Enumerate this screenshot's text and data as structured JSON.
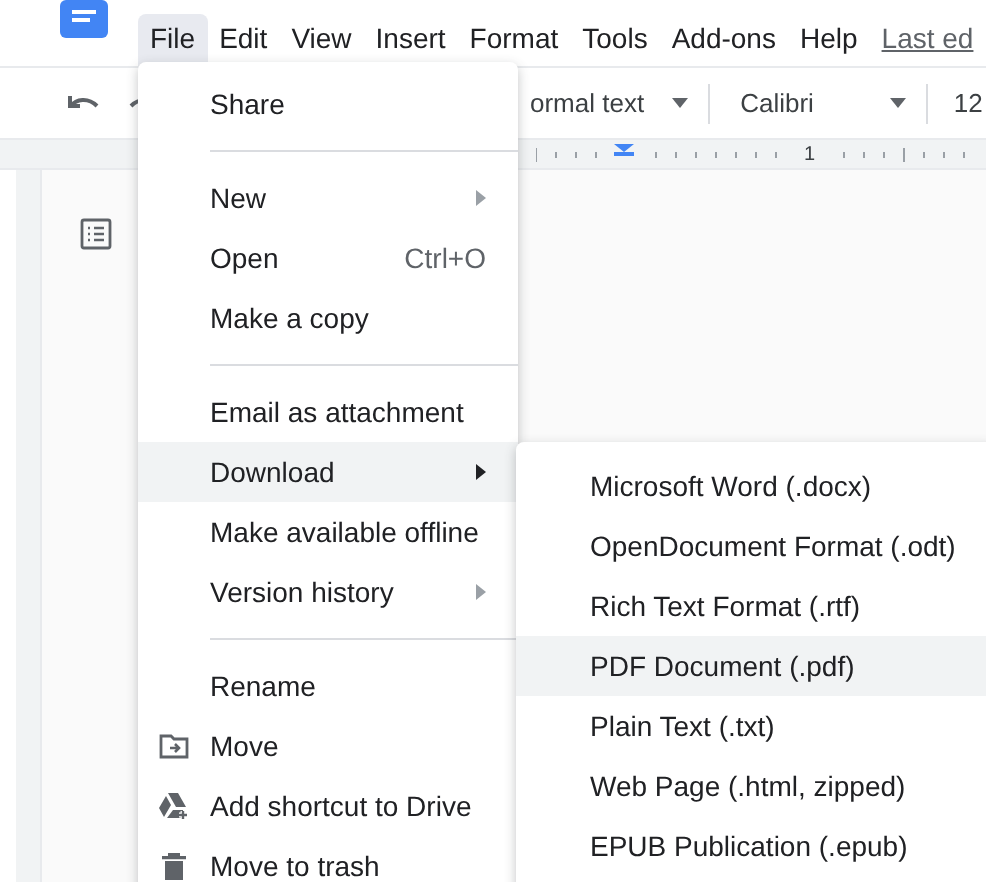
{
  "menu_bar": [
    {
      "label": "File",
      "selected": true
    },
    {
      "label": "Edit",
      "selected": false
    },
    {
      "label": "View",
      "selected": false
    },
    {
      "label": "Insert",
      "selected": false
    },
    {
      "label": "Format",
      "selected": false
    },
    {
      "label": "Tools",
      "selected": false
    },
    {
      "label": "Add-ons",
      "selected": false
    },
    {
      "label": "Help",
      "selected": false
    }
  ],
  "last_edit_link": "Last ed",
  "toolbar": {
    "style": "ormal text",
    "font": "Calibri",
    "font_size": "12"
  },
  "ruler_label": "1",
  "file_menu": [
    {
      "kind": "plain",
      "label": "Share"
    },
    {
      "kind": "separator"
    },
    {
      "kind": "plain",
      "label": "New",
      "submenu": true,
      "selected": false
    },
    {
      "kind": "plain",
      "label": "Open",
      "shortcut": "Ctrl+O"
    },
    {
      "kind": "plain",
      "label": "Make a copy"
    },
    {
      "kind": "separator"
    },
    {
      "kind": "plain",
      "label": "Email as attachment"
    },
    {
      "kind": "plain",
      "label": "Download",
      "submenu": true,
      "selected": true
    },
    {
      "kind": "plain",
      "label": "Make available offline"
    },
    {
      "kind": "plain",
      "label": "Version history",
      "submenu": true,
      "selected": false
    },
    {
      "kind": "separator"
    },
    {
      "kind": "plain",
      "label": "Rename"
    },
    {
      "kind": "folder",
      "label": "Move"
    },
    {
      "kind": "drive",
      "label": "Add shortcut to Drive"
    },
    {
      "kind": "trash",
      "label": "Move to trash"
    }
  ],
  "download_menu": [
    {
      "label": "Microsoft Word (.docx)",
      "selected": false
    },
    {
      "label": "OpenDocument Format (.odt)",
      "selected": false
    },
    {
      "label": "Rich Text Format (.rtf)",
      "selected": false
    },
    {
      "label": "PDF Document (.pdf)",
      "selected": true
    },
    {
      "label": "Plain Text (.txt)",
      "selected": false
    },
    {
      "label": "Web Page (.html, zipped)",
      "selected": false
    },
    {
      "label": "EPUB Publication (.epub)",
      "selected": false
    }
  ]
}
